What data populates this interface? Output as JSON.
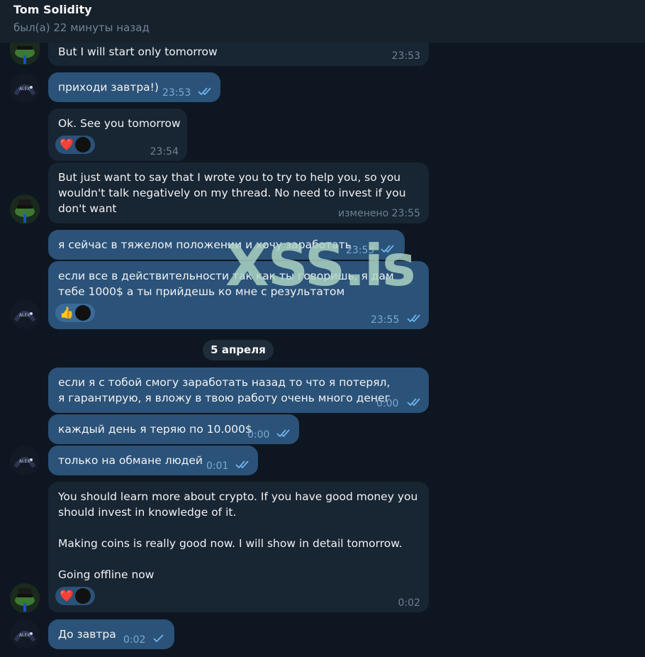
{
  "header": {
    "contact_name": "Tom Solidity",
    "status": "был(а) 22 минуты назад"
  },
  "messages": [
    {
      "direction": "in",
      "text": "But I will start only tomorrow",
      "time": "23:53"
    },
    {
      "direction": "out",
      "text": "приходи завтра!)",
      "time": "23:53"
    },
    {
      "direction": "in",
      "text": "Ok. See you tomorrow",
      "time": "23:54",
      "reaction": "❤️"
    },
    {
      "direction": "in",
      "text": "But just want to say that I wrote you to try to help you, so you wouldn't talk negatively on my thread. No need to invest if you don't want",
      "time": "изменено 23:55"
    },
    {
      "direction": "out",
      "text": "я сейчас в тяжелом положении и хочу заработать",
      "time": "23:55"
    },
    {
      "direction": "out",
      "text": "если все в действительности так как ты говоришь, я дам тебе 1000$ а ты прийдешь ко мне с результатом",
      "time": "23:55",
      "reaction": "👍"
    },
    {
      "direction": "out",
      "text": "если я с тобой смогу заработать назад то что я потерял, я гарантирую, я вложу в твою работу очень много денег",
      "time": "0:00"
    },
    {
      "direction": "out",
      "text": "каждый день я теряю по 10.000$",
      "time": "0:00"
    },
    {
      "direction": "out",
      "text": "только на обмане людей",
      "time": "0:01"
    },
    {
      "direction": "in",
      "text": "You should learn more about crypto. If you have good money you should invest in knowledge of it.\n\nMaking coins is really good now. I will show in detail tomorrow.\n\nGoing offline now",
      "time": "0:02",
      "reaction": "❤️"
    },
    {
      "direction": "out",
      "text": "До завтра",
      "time": "0:02"
    }
  ],
  "date_separator": "5 апреля",
  "watermark": "XSS.is",
  "colors": {
    "background": "#0e1621",
    "incoming_bubble": "#182533",
    "outgoing_bubble": "#2b5278",
    "read_check": "#5fb0f0"
  }
}
